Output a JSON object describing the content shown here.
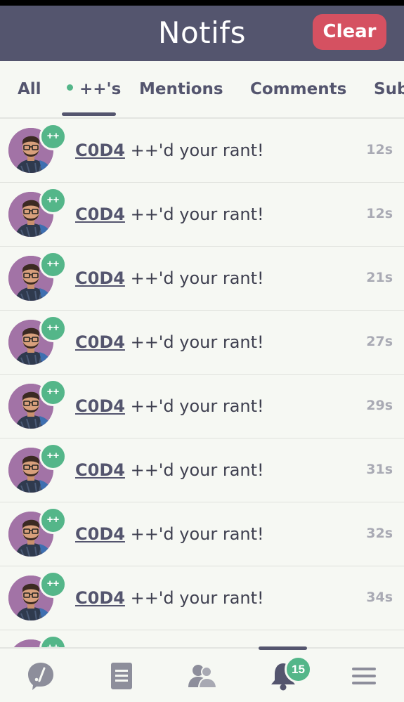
{
  "header": {
    "title": "Notifs",
    "clear_label": "Clear"
  },
  "tabs": [
    {
      "label": "All"
    },
    {
      "label": "++'s",
      "active": true,
      "has_dot": true
    },
    {
      "label": "Mentions"
    },
    {
      "label": "Comments"
    },
    {
      "label": "Sub"
    }
  ],
  "notifications": [
    {
      "user": "C0D4",
      "message": "++'d your rant!",
      "time": "12s",
      "badge": "++"
    },
    {
      "user": "C0D4",
      "message": "++'d your rant!",
      "time": "12s",
      "badge": "++"
    },
    {
      "user": "C0D4",
      "message": "++'d your rant!",
      "time": "21s",
      "badge": "++"
    },
    {
      "user": "C0D4",
      "message": "++'d your rant!",
      "time": "27s",
      "badge": "++"
    },
    {
      "user": "C0D4",
      "message": "++'d your rant!",
      "time": "29s",
      "badge": "++"
    },
    {
      "user": "C0D4",
      "message": "++'d your rant!",
      "time": "31s",
      "badge": "++"
    },
    {
      "user": "C0D4",
      "message": "++'d your rant!",
      "time": "32s",
      "badge": "++"
    },
    {
      "user": "C0D4",
      "message": "++'d your rant!",
      "time": "34s",
      "badge": "++"
    },
    {
      "user": "",
      "message": "",
      "time": "",
      "badge": "++"
    }
  ],
  "bottom_nav": {
    "items": [
      {
        "icon": "rant-feed-icon"
      },
      {
        "icon": "document-icon"
      },
      {
        "icon": "people-icon"
      },
      {
        "icon": "bell-icon",
        "active": true
      },
      {
        "icon": "menu-icon"
      }
    ],
    "notif_count": "15"
  },
  "colors": {
    "header_bg": "#54556e",
    "accent_green": "#54b689",
    "clear_red": "#d55161",
    "page_bg": "#f6f8f3",
    "avatar_bg": "#a273a6"
  }
}
